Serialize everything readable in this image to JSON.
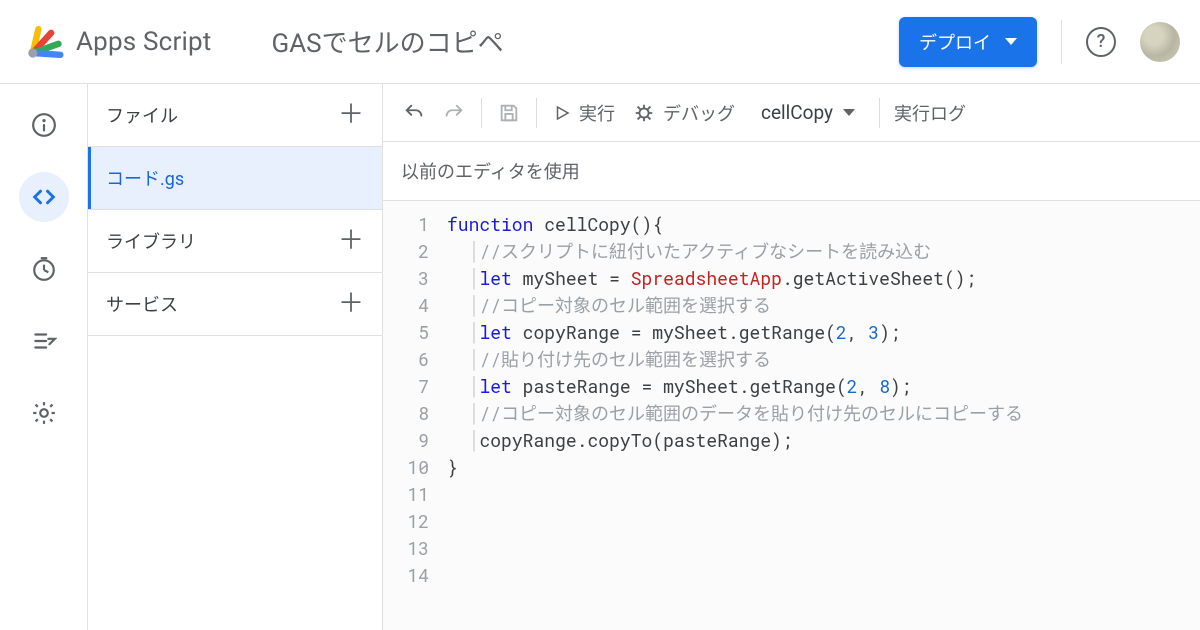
{
  "header": {
    "brand": "Apps Script",
    "project_title": "GASでセルのコピペ",
    "deploy_label": "デプロイ"
  },
  "rail": {
    "items": [
      "info",
      "editor",
      "triggers",
      "executions",
      "settings"
    ],
    "active": "editor"
  },
  "filepane": {
    "files_label": "ファイル",
    "libraries_label": "ライブラリ",
    "services_label": "サービス",
    "file_name": "コード.gs"
  },
  "toolbar": {
    "run_label": "実行",
    "debug_label": "デバッグ",
    "function_name": "cellCopy",
    "exec_log_label": "実行ログ"
  },
  "old_editor_label": "以前のエディタを使用",
  "code": {
    "lines": 14,
    "fn_name": "cellCopy",
    "comment1": "//スクリプトに紐付いたアクティブなシートを読み込む",
    "line3_var": "mySheet",
    "line3_class": "SpreadsheetApp",
    "line3_method": "getActiveSheet",
    "comment2": "//コピー対象のセル範囲を選択する",
    "line5_var": "copyRange",
    "line5_obj": "mySheet",
    "line5_method": "getRange",
    "line5_arg1": "2",
    "line5_arg2": "3",
    "comment3": "//貼り付け先のセル範囲を選択する",
    "line7_var": "pasteRange",
    "line7_obj": "mySheet",
    "line7_method": "getRange",
    "line7_arg1": "2",
    "line7_arg2": "8",
    "comment4": "//コピー対象のセル範囲のデータを貼り付け先のセルにコピーする",
    "line9_obj": "copyRange",
    "line9_method": "copyTo",
    "line9_arg": "pasteRange",
    "kw_function": "function",
    "kw_let": "let"
  }
}
